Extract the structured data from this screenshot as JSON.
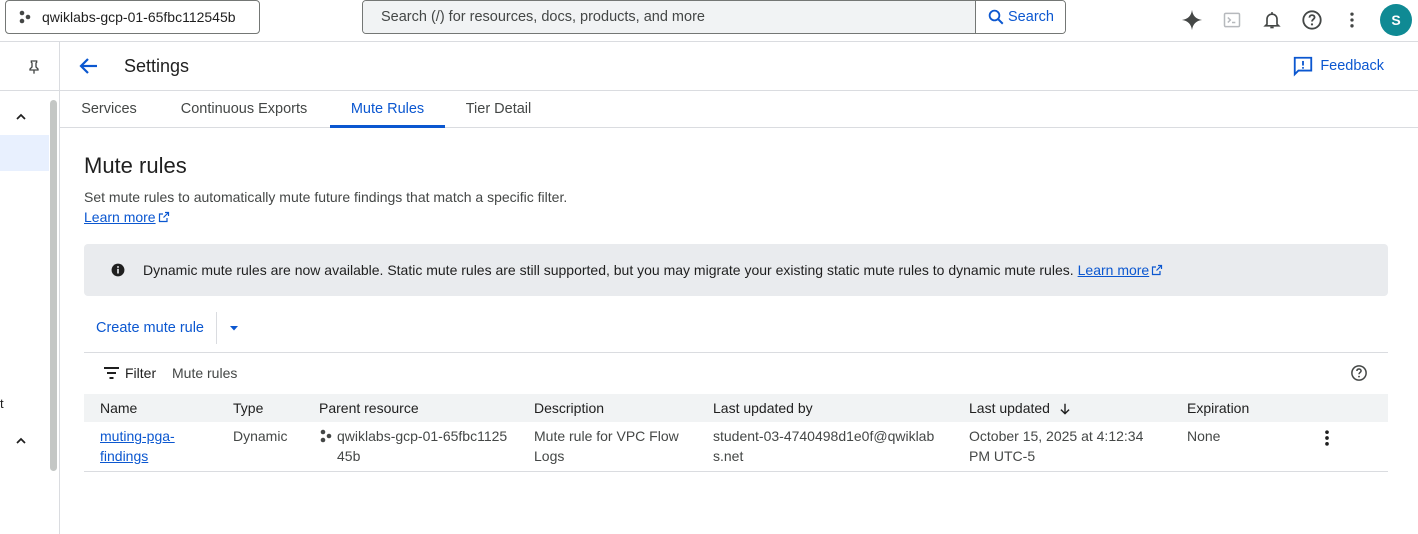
{
  "topbar": {
    "project_name": "qwiklabs-gcp-01-65fbc112545b",
    "search_placeholder": "Search (/) for resources, docs, products, and more",
    "search_button": "Search",
    "avatar_initial": "S"
  },
  "leftrail": {
    "partial_text": "t"
  },
  "page": {
    "title": "Settings",
    "feedback": "Feedback"
  },
  "tabs": [
    {
      "label": "Services"
    },
    {
      "label": "Continuous Exports"
    },
    {
      "label": "Mute Rules"
    },
    {
      "label": "Tier Detail"
    }
  ],
  "active_tab": "Mute Rules",
  "section": {
    "title": "Mute rules",
    "description": "Set mute rules to automatically mute future findings that match a specific filter.",
    "learn_more": "Learn more"
  },
  "banner": {
    "text": "Dynamic mute rules are now available. Static mute rules are still supported, but you may migrate your existing static mute rules to dynamic mute rules.",
    "link": "Learn more"
  },
  "actions": {
    "create_label": "Create mute rule"
  },
  "filter": {
    "label": "Filter",
    "placeholder": "Mute rules"
  },
  "table": {
    "columns": [
      "Name",
      "Type",
      "Parent resource",
      "Description",
      "Last updated by",
      "Last updated",
      "Expiration"
    ],
    "sort_column": "Last updated",
    "sort_direction": "descending",
    "rows": [
      {
        "name": "muting-pga-findings",
        "type": "Dynamic",
        "parent": "qwiklabs-gcp-01-65fbc112545b",
        "description": "Mute rule for VPC Flow Logs",
        "updated_by": "student-03-4740498d1e0f@qwiklabs.net",
        "updated": "October 15, 2025 at 4:12:34 PM UTC-5",
        "expiration": "None"
      }
    ]
  },
  "colors": {
    "accent": "#0b57d0",
    "avatar": "#0f8a94",
    "banner_bg": "#e9ebee",
    "header_bg": "#f1f3f4"
  }
}
